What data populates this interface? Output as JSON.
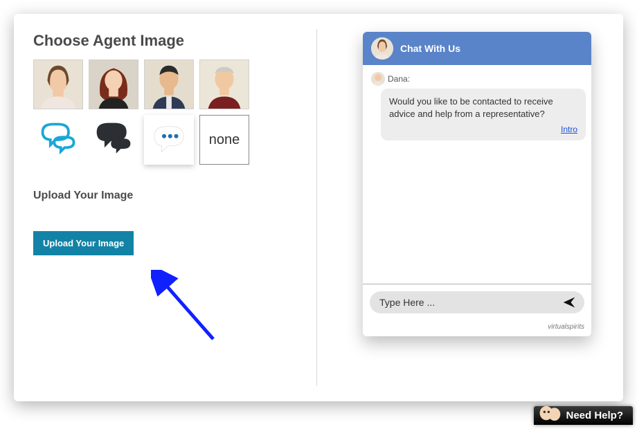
{
  "left": {
    "choose_heading": "Choose Agent Image",
    "none_label": "none",
    "upload_heading": "Upload Your Image",
    "upload_button": "Upload Your Image"
  },
  "chat": {
    "header_title": "Chat With Us",
    "sender_label": "Dana:",
    "bubble_text": "Would you like to be contacted to receive advice and help from a representative?",
    "intro_link": "Intro",
    "input_placeholder": "Type Here ...",
    "brand": "virtualspirits"
  },
  "need_help": {
    "label": "Need Help?"
  }
}
